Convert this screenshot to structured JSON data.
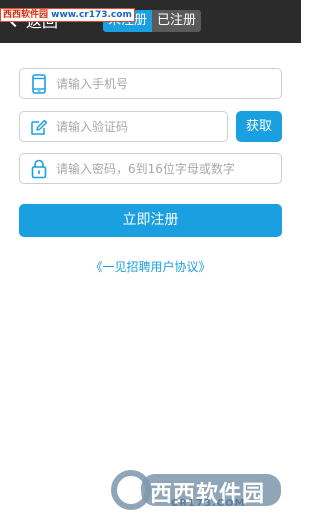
{
  "header": {
    "back_label": "返回",
    "tabs": [
      {
        "label": "未注册",
        "active": true
      },
      {
        "label": "已注册",
        "active": false
      }
    ]
  },
  "watermark_top": {
    "part1": "西西软件园",
    "part2": "www.cr173.com"
  },
  "form": {
    "phone_placeholder": "请输入手机号",
    "code_placeholder": "请输入验证码",
    "get_code_label": "获取",
    "password_placeholder": "请输入密码，6到16位字母或数字",
    "register_label": "立即注册",
    "agreement_label": "《一见招聘用户协议》"
  },
  "watermark_logo": {
    "title": "西西软件园",
    "sub": "CR173.COM"
  },
  "colors": {
    "accent": "#1a9fe1",
    "header_bg": "#2b2b2b",
    "border": "#cfcfcf"
  }
}
